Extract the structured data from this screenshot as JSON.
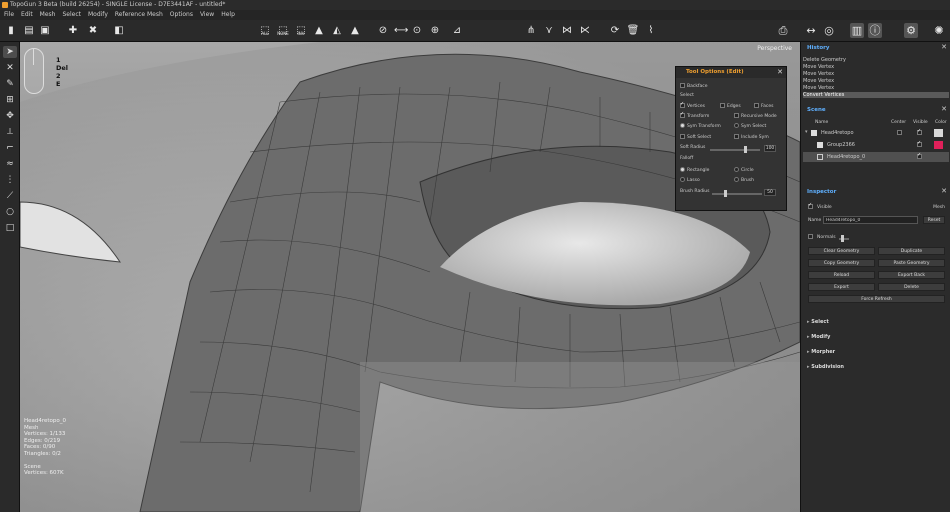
{
  "window": {
    "title": "TopoGun 3 Beta (build 26254) - SINGLE License - D7E3441AF - untitled*"
  },
  "menu": [
    "File",
    "Edit",
    "Mesh",
    "Select",
    "Modify",
    "Reference Mesh",
    "Options",
    "View",
    "Help"
  ],
  "toolbar": {
    "select_all": "ALL",
    "select_none": "NONE",
    "select_invert": "INV"
  },
  "viewport": {
    "mode_label": "Perspective",
    "key_hints": [
      "1",
      "Del",
      "2",
      "E"
    ],
    "stats": [
      "Head4retopo_0",
      "Mesh",
      "Vertices:   1/133",
      "Edges:   0/219",
      "Faces:   0/90",
      "Triangles:   0/2",
      "",
      "Scene",
      "Vertices:   607K"
    ]
  },
  "tool_options": {
    "title": "Tool Options (Edit)",
    "backface": "Backface",
    "select_label": "Select",
    "vertices": "Vertices",
    "edges": "Edges",
    "faces": "Faces",
    "transform": "Transform",
    "recursive_mode": "Recursive Mode",
    "sym_transform": "Sym Transform",
    "sym_select": "Sym Select",
    "soft_select": "Soft Select",
    "include_sym": "Include Sym",
    "soft_radius_label": "Soft Radius",
    "soft_radius_value": "100",
    "falloff_label": "Falloff",
    "rectangle": "Rectangle",
    "circle": "Circle",
    "lasso": "Lasso",
    "brush": "Brush",
    "brush_radius_label": "Brush Radius",
    "brush_radius_value": "50"
  },
  "history": {
    "title": "History",
    "items": [
      "Delete Geometry",
      "Move Vertex",
      "Move Vertex",
      "Move Vertex",
      "Move Vertex",
      "Convert Vertices"
    ],
    "selected_index": 5
  },
  "scene": {
    "title": "Scene",
    "columns": [
      "Name",
      "Center",
      "Visible",
      "Color"
    ],
    "items": [
      {
        "name": "Head4retopo",
        "color": "#d8d8d8"
      },
      {
        "name": "Group2366",
        "color": "#e0205a"
      },
      {
        "name": "Head4retopo_0",
        "color": "#bdbdbd"
      }
    ]
  },
  "inspector": {
    "title": "Inspector",
    "visible_label": "Visible",
    "type_label": "Mesh",
    "name_label": "Name",
    "name_value": "Head4retopo_0",
    "reset": "Reset",
    "normals": "Normals",
    "buttons": [
      "Clear Geometry",
      "Duplicate",
      "Copy Geometry",
      "Paste Geometry",
      "Reload",
      "Export Back",
      "Export",
      "Delete"
    ],
    "force_refresh": "Force Refresh"
  },
  "accordions": [
    "Select",
    "Modify",
    "Morpher",
    "Subdivision"
  ],
  "colors": {
    "accent": "#f0a030",
    "panel_title": "#5fb0ff",
    "selected_row": "#5a5a5a"
  }
}
